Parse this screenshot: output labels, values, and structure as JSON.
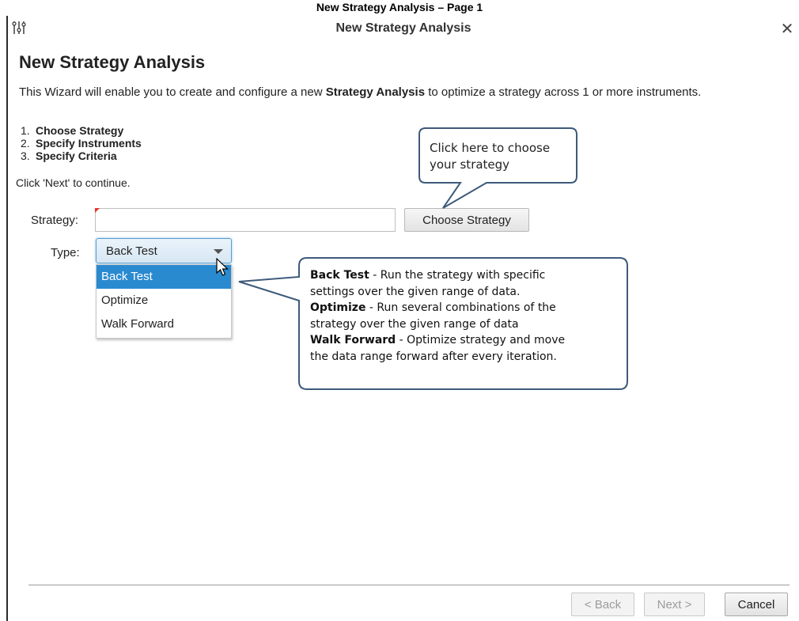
{
  "page_caption": "New Strategy Analysis – Page 1",
  "window": {
    "title": "New Strategy Analysis",
    "icon": "settings-sliders-icon",
    "close_glyph": "✕"
  },
  "heading": "New Strategy Analysis",
  "intro": {
    "before": "This Wizard will enable you to create and configure a new ",
    "bold": "Strategy Analysis",
    "after": " to optimize a strategy across 1 or more instruments."
  },
  "steps": [
    {
      "num": "1.",
      "label": "Choose Strategy"
    },
    {
      "num": "2.",
      "label": "Specify Instruments"
    },
    {
      "num": "3.",
      "label": "Specify Criteria"
    }
  ],
  "continue_text": "Click 'Next' to continue.",
  "form": {
    "strategy_label": "Strategy:",
    "strategy_value": "",
    "choose_button": "Choose Strategy",
    "type_label": "Type:",
    "type_value": "Back Test",
    "type_options": [
      "Back Test",
      "Optimize",
      "Walk Forward"
    ]
  },
  "callouts": {
    "choose": {
      "line1": "Click here to choose",
      "line2": "your strategy"
    },
    "types": [
      {
        "bold": "Back Test",
        "text": " - Run the strategy with specific"
      },
      {
        "bold": "",
        "text": "settings over the given range of data."
      },
      {
        "bold": "Optimize",
        "text": " - Run several combinations of the"
      },
      {
        "bold": "",
        "text": "strategy over the given range of data"
      },
      {
        "bold": "Walk Forward",
        "text": " - Optimize strategy and move"
      },
      {
        "bold": "",
        "text": "the data range forward after every iteration."
      }
    ]
  },
  "footer": {
    "back": "< Back",
    "next": "Next >",
    "cancel": "Cancel"
  },
  "colors": {
    "selection": "#2a8ad0",
    "callout_border": "#3d5a7a",
    "required_marker": "#e8332a"
  }
}
